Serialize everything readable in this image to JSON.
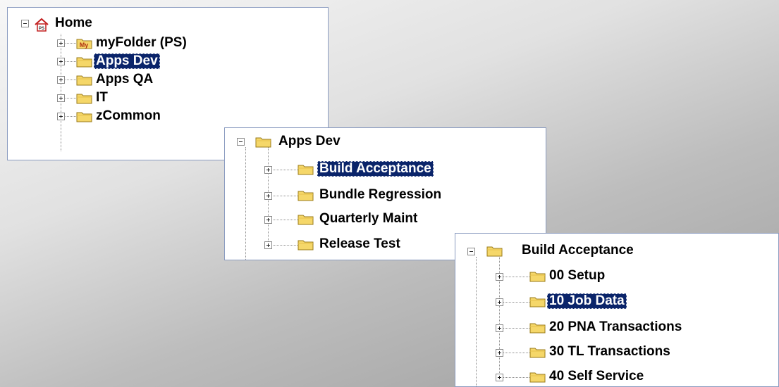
{
  "panels": [
    {
      "root": {
        "label": "Home",
        "icon": "home-icon"
      },
      "children": [
        {
          "label": "myFolder (PS)",
          "icon": "my-folder-icon",
          "selected": false
        },
        {
          "label": "Apps Dev",
          "icon": "folder-icon",
          "selected": true
        },
        {
          "label": "Apps QA",
          "icon": "folder-icon",
          "selected": false
        },
        {
          "label": "IT",
          "icon": "folder-icon",
          "selected": false
        },
        {
          "label": "zCommon",
          "icon": "folder-icon",
          "selected": false
        }
      ]
    },
    {
      "root": {
        "label": "Apps Dev",
        "icon": "folder-icon"
      },
      "children": [
        {
          "label": "Build Acceptance",
          "icon": "folder-icon",
          "selected": true
        },
        {
          "label": "Bundle Regression",
          "icon": "folder-icon",
          "selected": false
        },
        {
          "label": "Quarterly Maint",
          "icon": "folder-icon",
          "selected": false
        },
        {
          "label": "Release Test",
          "icon": "folder-icon",
          "selected": false
        }
      ]
    },
    {
      "root": {
        "label": "Build Acceptance",
        "icon": "folder-icon"
      },
      "children": [
        {
          "label": "00 Setup",
          "icon": "folder-icon",
          "selected": false
        },
        {
          "label": "10 Job Data",
          "icon": "folder-icon",
          "selected": true
        },
        {
          "label": "20 PNA Transactions",
          "icon": "folder-icon",
          "selected": false
        },
        {
          "label": "30 TL Transactions",
          "icon": "folder-icon",
          "selected": false
        },
        {
          "label": "40 Self Service",
          "icon": "folder-icon",
          "selected": false
        }
      ]
    }
  ],
  "colors": {
    "selection_bg": "#0a246a",
    "folder_fill": "#f5d769",
    "folder_edge": "#9a7b1a",
    "home_red": "#c21f1f"
  }
}
